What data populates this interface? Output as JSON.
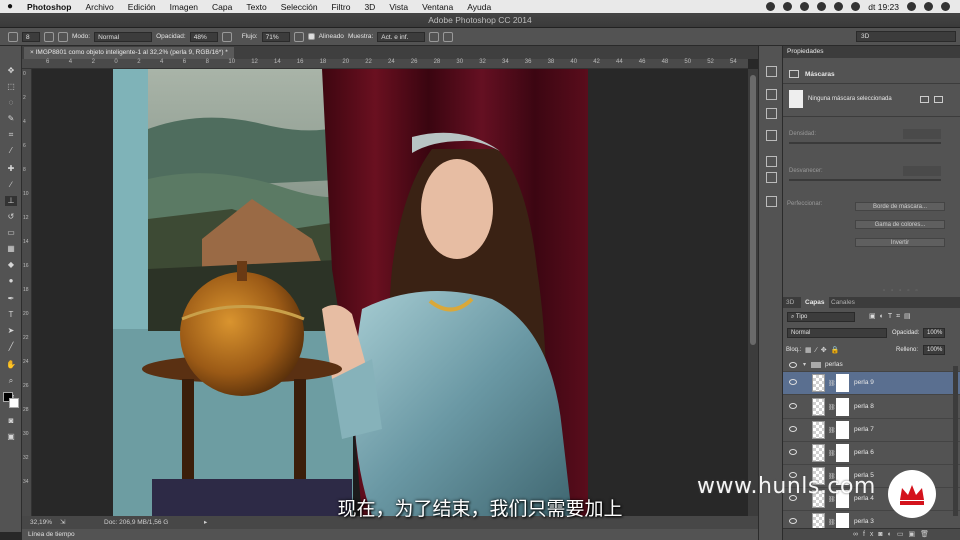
{
  "macbar": {
    "app": "Photoshop",
    "menus": [
      "Archivo",
      "Edición",
      "Imagen",
      "Capa",
      "Texto",
      "Selección",
      "Filtro",
      "3D",
      "Vista",
      "Ventana",
      "Ayuda"
    ],
    "clock": "dt 19:23"
  },
  "window": {
    "title": "Adobe Photoshop CC 2014"
  },
  "options": {
    "brush_size": "8",
    "mode_label": "Modo:",
    "mode_value": "Normal",
    "opacity_label": "Opacidad:",
    "opacity_value": "48%",
    "flow_label": "Flujo:",
    "flow_value": "71%",
    "aligned_label": "Alineado",
    "sample_label": "Muestra:",
    "sample_value": "Act. e inf.",
    "workspace": "3D"
  },
  "document": {
    "tab_title": "IMGP8801 como objeto inteligente-1 al 32,2% (perla 9, RGB/16*) *",
    "ruler_labels": [
      "6",
      "4",
      "2",
      "0",
      "2",
      "4",
      "6",
      "8",
      "10",
      "12",
      "14",
      "16",
      "18",
      "20",
      "22",
      "24",
      "26",
      "28",
      "30",
      "32",
      "34",
      "36",
      "38",
      "40",
      "42",
      "44",
      "46",
      "48",
      "50",
      "52",
      "54"
    ],
    "vruler_labels": [
      "0",
      "2",
      "4",
      "6",
      "8",
      "10",
      "12",
      "14",
      "16",
      "18",
      "20",
      "22",
      "24",
      "26",
      "28",
      "30",
      "32",
      "34"
    ]
  },
  "status": {
    "zoom": "32,19%",
    "doc_size": "Doc: 206,9 MB/1,56 G"
  },
  "timeline": {
    "label": "Línea de tiempo"
  },
  "properties": {
    "tab": "Propiedades",
    "section": "Máscaras",
    "mask_status": "Ninguna máscara seleccionada",
    "density_label": "Densidad:",
    "feather_label": "Desvanecer:",
    "refine_label": "Perfeccionar:",
    "btn_mask_edge": "Borde de máscara...",
    "btn_color_range": "Gama de colores...",
    "btn_invert": "Invertir"
  },
  "layers_panel": {
    "tabs": [
      "3D",
      "Capas",
      "Canales"
    ],
    "filter_label": "Tipo",
    "blend_mode": "Normal",
    "opacity_label": "Opacidad:",
    "opacity_value": "100%",
    "lock_label": "Bloq.:",
    "fill_label": "Relleno:",
    "fill_value": "100%",
    "group_name": "perlas",
    "layers": [
      "perla 9",
      "perla 8",
      "perla 7",
      "perla 6",
      "perla 5",
      "perla 4",
      "perla 3"
    ],
    "selected_layer": "perla 9"
  },
  "overlay": {
    "subtitle": "现在，为了结束，我们只需要加上",
    "watermark": "www.hunls.com"
  },
  "colors": {
    "accent_selected": "#5a6f90",
    "curtain": "#5a0f1a",
    "wall": "#7fb3b8"
  }
}
